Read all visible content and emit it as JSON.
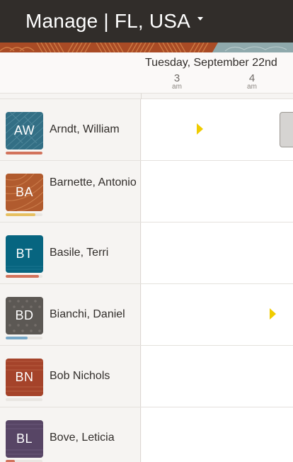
{
  "header": {
    "title": "Manage | FL, USA"
  },
  "timeline": {
    "date_label": "Tuesday, September 22nd",
    "hours": [
      {
        "hour": "3",
        "suffix": "am"
      },
      {
        "hour": "4",
        "suffix": "am"
      }
    ]
  },
  "people": [
    {
      "initials": "AW",
      "name": "Arndt, William",
      "avatar_color": "#336f85",
      "status_color": "#d2735c",
      "status_fraction": 1.0
    },
    {
      "initials": "BA",
      "name": "Barnette, Antonio",
      "avatar_color": "#b15b2e",
      "status_color": "#e7c060",
      "status_fraction": 0.8
    },
    {
      "initials": "BT",
      "name": "Basile, Terri",
      "avatar_color": "#076580",
      "status_color": "#d2735c",
      "status_fraction": 0.9
    },
    {
      "initials": "BD",
      "name": "Bianchi, Daniel",
      "avatar_color": "#5c5854",
      "status_color": "#77a8c8",
      "status_fraction": 0.6
    },
    {
      "initials": "BN",
      "name": "Bob Nichols",
      "avatar_color": "#a5432a",
      "status_color": "#e9e6e2",
      "status_fraction": 0.0
    },
    {
      "initials": "BL",
      "name": "Bove, Leticia",
      "avatar_color": "#574565",
      "status_color": "#d2735c",
      "status_fraction": 0.25
    }
  ],
  "colors": {
    "header_bg": "#312d2a",
    "shift_marker": "#f0cc00"
  }
}
